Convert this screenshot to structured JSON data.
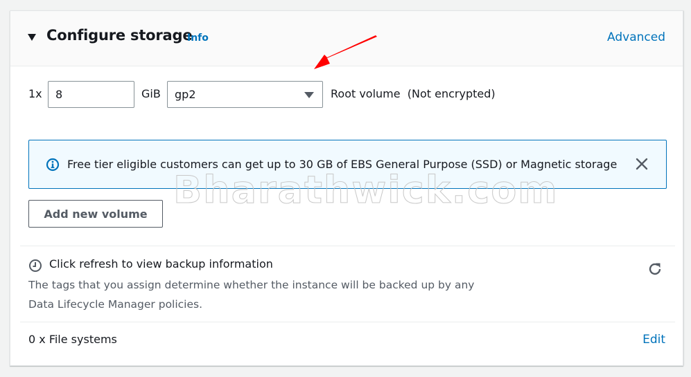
{
  "header": {
    "title": "Configure storage",
    "info_link": "Info",
    "advanced_link": "Advanced",
    "collapse_icon": "caret-down-icon"
  },
  "volume": {
    "quantity_label": "1x",
    "size_value": "8",
    "size_unit": "GiB",
    "volume_type": "gp2",
    "description": "Root volume  (Not encrypted)"
  },
  "alert": {
    "icon": "info-circle-icon",
    "message": "Free tier eligible customers can get up to 30 GB of EBS General Purpose (SSD) or Magnetic storage",
    "close_icon": "close-icon",
    "color": "#0073bb"
  },
  "add_volume_button": "Add new volume",
  "backup": {
    "icon": "clock-icon",
    "title": "Click refresh to view backup information",
    "description": "The tags that you assign determine whether the instance will be backed up by any Data Lifecycle Manager policies.",
    "refresh_icon": "refresh-icon"
  },
  "file_systems": {
    "label": "0 x File systems",
    "edit_link": "Edit"
  },
  "annotation": {
    "arrow_color": "#ff0000"
  },
  "watermark": "Bharathwick.com",
  "colors": {
    "link": "#0073bb",
    "text": "#16191f",
    "secondary_text": "#545b64",
    "alert_bg": "#f1faff"
  }
}
